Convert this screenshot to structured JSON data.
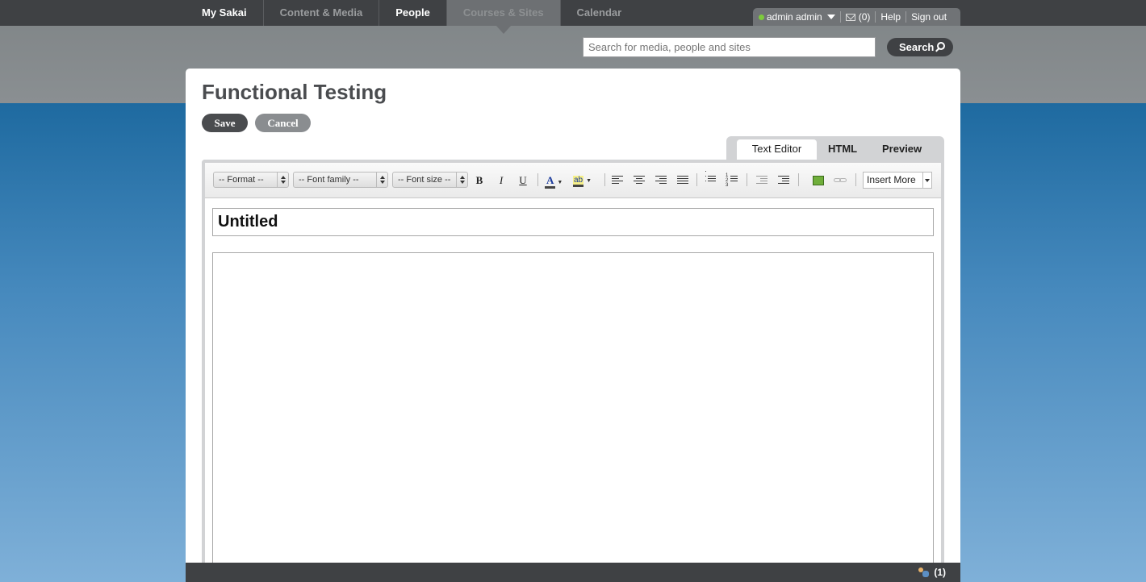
{
  "nav": {
    "items": [
      "My Sakai",
      "Content & Media",
      "People",
      "Courses & Sites",
      "Calendar"
    ]
  },
  "user": {
    "name": "admin admin",
    "messages": "(0)",
    "help": "Help",
    "signout": "Sign out"
  },
  "search": {
    "placeholder": "Search for media, people and sites",
    "button": "Search"
  },
  "page": {
    "title": "Functional Testing",
    "save": "Save",
    "cancel": "Cancel"
  },
  "tabs": [
    "Text Editor",
    "HTML",
    "Preview"
  ],
  "toolbar": {
    "format": "-- Format --",
    "font_family": "-- Font family --",
    "font_size": "-- Font size --",
    "bold": "B",
    "italic": "I",
    "underline": "U",
    "text_color": "A",
    "highlight": "ab",
    "insert_more": "Insert More"
  },
  "editor": {
    "title_value": "Untitled"
  },
  "chat": {
    "count": "(1)"
  },
  "colors": {
    "topbar": "#3f4144",
    "online": "#7dcb3c",
    "accent_blue": "#1e6aa0"
  }
}
